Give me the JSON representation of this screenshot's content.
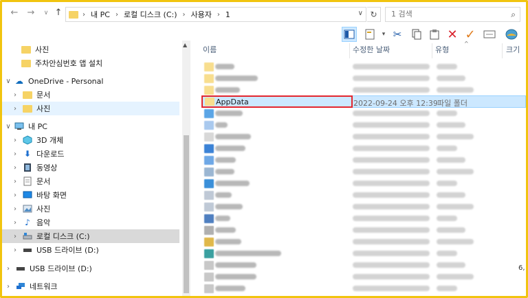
{
  "address": {
    "crumbs": [
      "내 PC",
      "로컬 디스크 (C:)",
      "사용자",
      "1"
    ],
    "separator": "›",
    "refresh_icon": "refresh-icon"
  },
  "search": {
    "placeholder": "1 검색"
  },
  "nav": {
    "items": [
      {
        "label": "사진",
        "icon": "folder-icon"
      },
      {
        "label": "주차안심번호 앱 설치",
        "icon": "folder-icon"
      },
      {
        "label": "OneDrive - Personal",
        "icon": "cloud-icon"
      },
      {
        "label": "문서",
        "icon": "folder-icon"
      },
      {
        "label": "사진",
        "icon": "folder-icon"
      },
      {
        "label": "내 PC",
        "icon": "pc-icon"
      },
      {
        "label": "3D 개체",
        "icon": "cube-icon"
      },
      {
        "label": "다운로드",
        "icon": "download-icon"
      },
      {
        "label": "동영상",
        "icon": "video-icon"
      },
      {
        "label": "문서",
        "icon": "document-icon"
      },
      {
        "label": "바탕 화면",
        "icon": "desktop-icon"
      },
      {
        "label": "사진",
        "icon": "pictures-icon"
      },
      {
        "label": "음악",
        "icon": "music-icon"
      },
      {
        "label": "로컬 디스크 (C:)",
        "icon": "drive-icon"
      },
      {
        "label": "USB 드라이브 (D:)",
        "icon": "usb-icon"
      },
      {
        "label": "USB 드라이브 (D:)",
        "icon": "usb-icon"
      },
      {
        "label": "네트워크",
        "icon": "network-icon"
      }
    ]
  },
  "columns": {
    "name": "이름",
    "modified": "수정한 날짜",
    "type": "유형",
    "size": "크기"
  },
  "files": {
    "selected": {
      "name": "AppData",
      "modified": "2022-09-24 오후 12:39",
      "type": "파일 폴더"
    },
    "trailing_size_fragment": "6,"
  },
  "colors": {
    "accent": "#0078d7",
    "frame": "#f1c40f",
    "highlight": "#e3262e",
    "selection": "#cce8ff"
  }
}
